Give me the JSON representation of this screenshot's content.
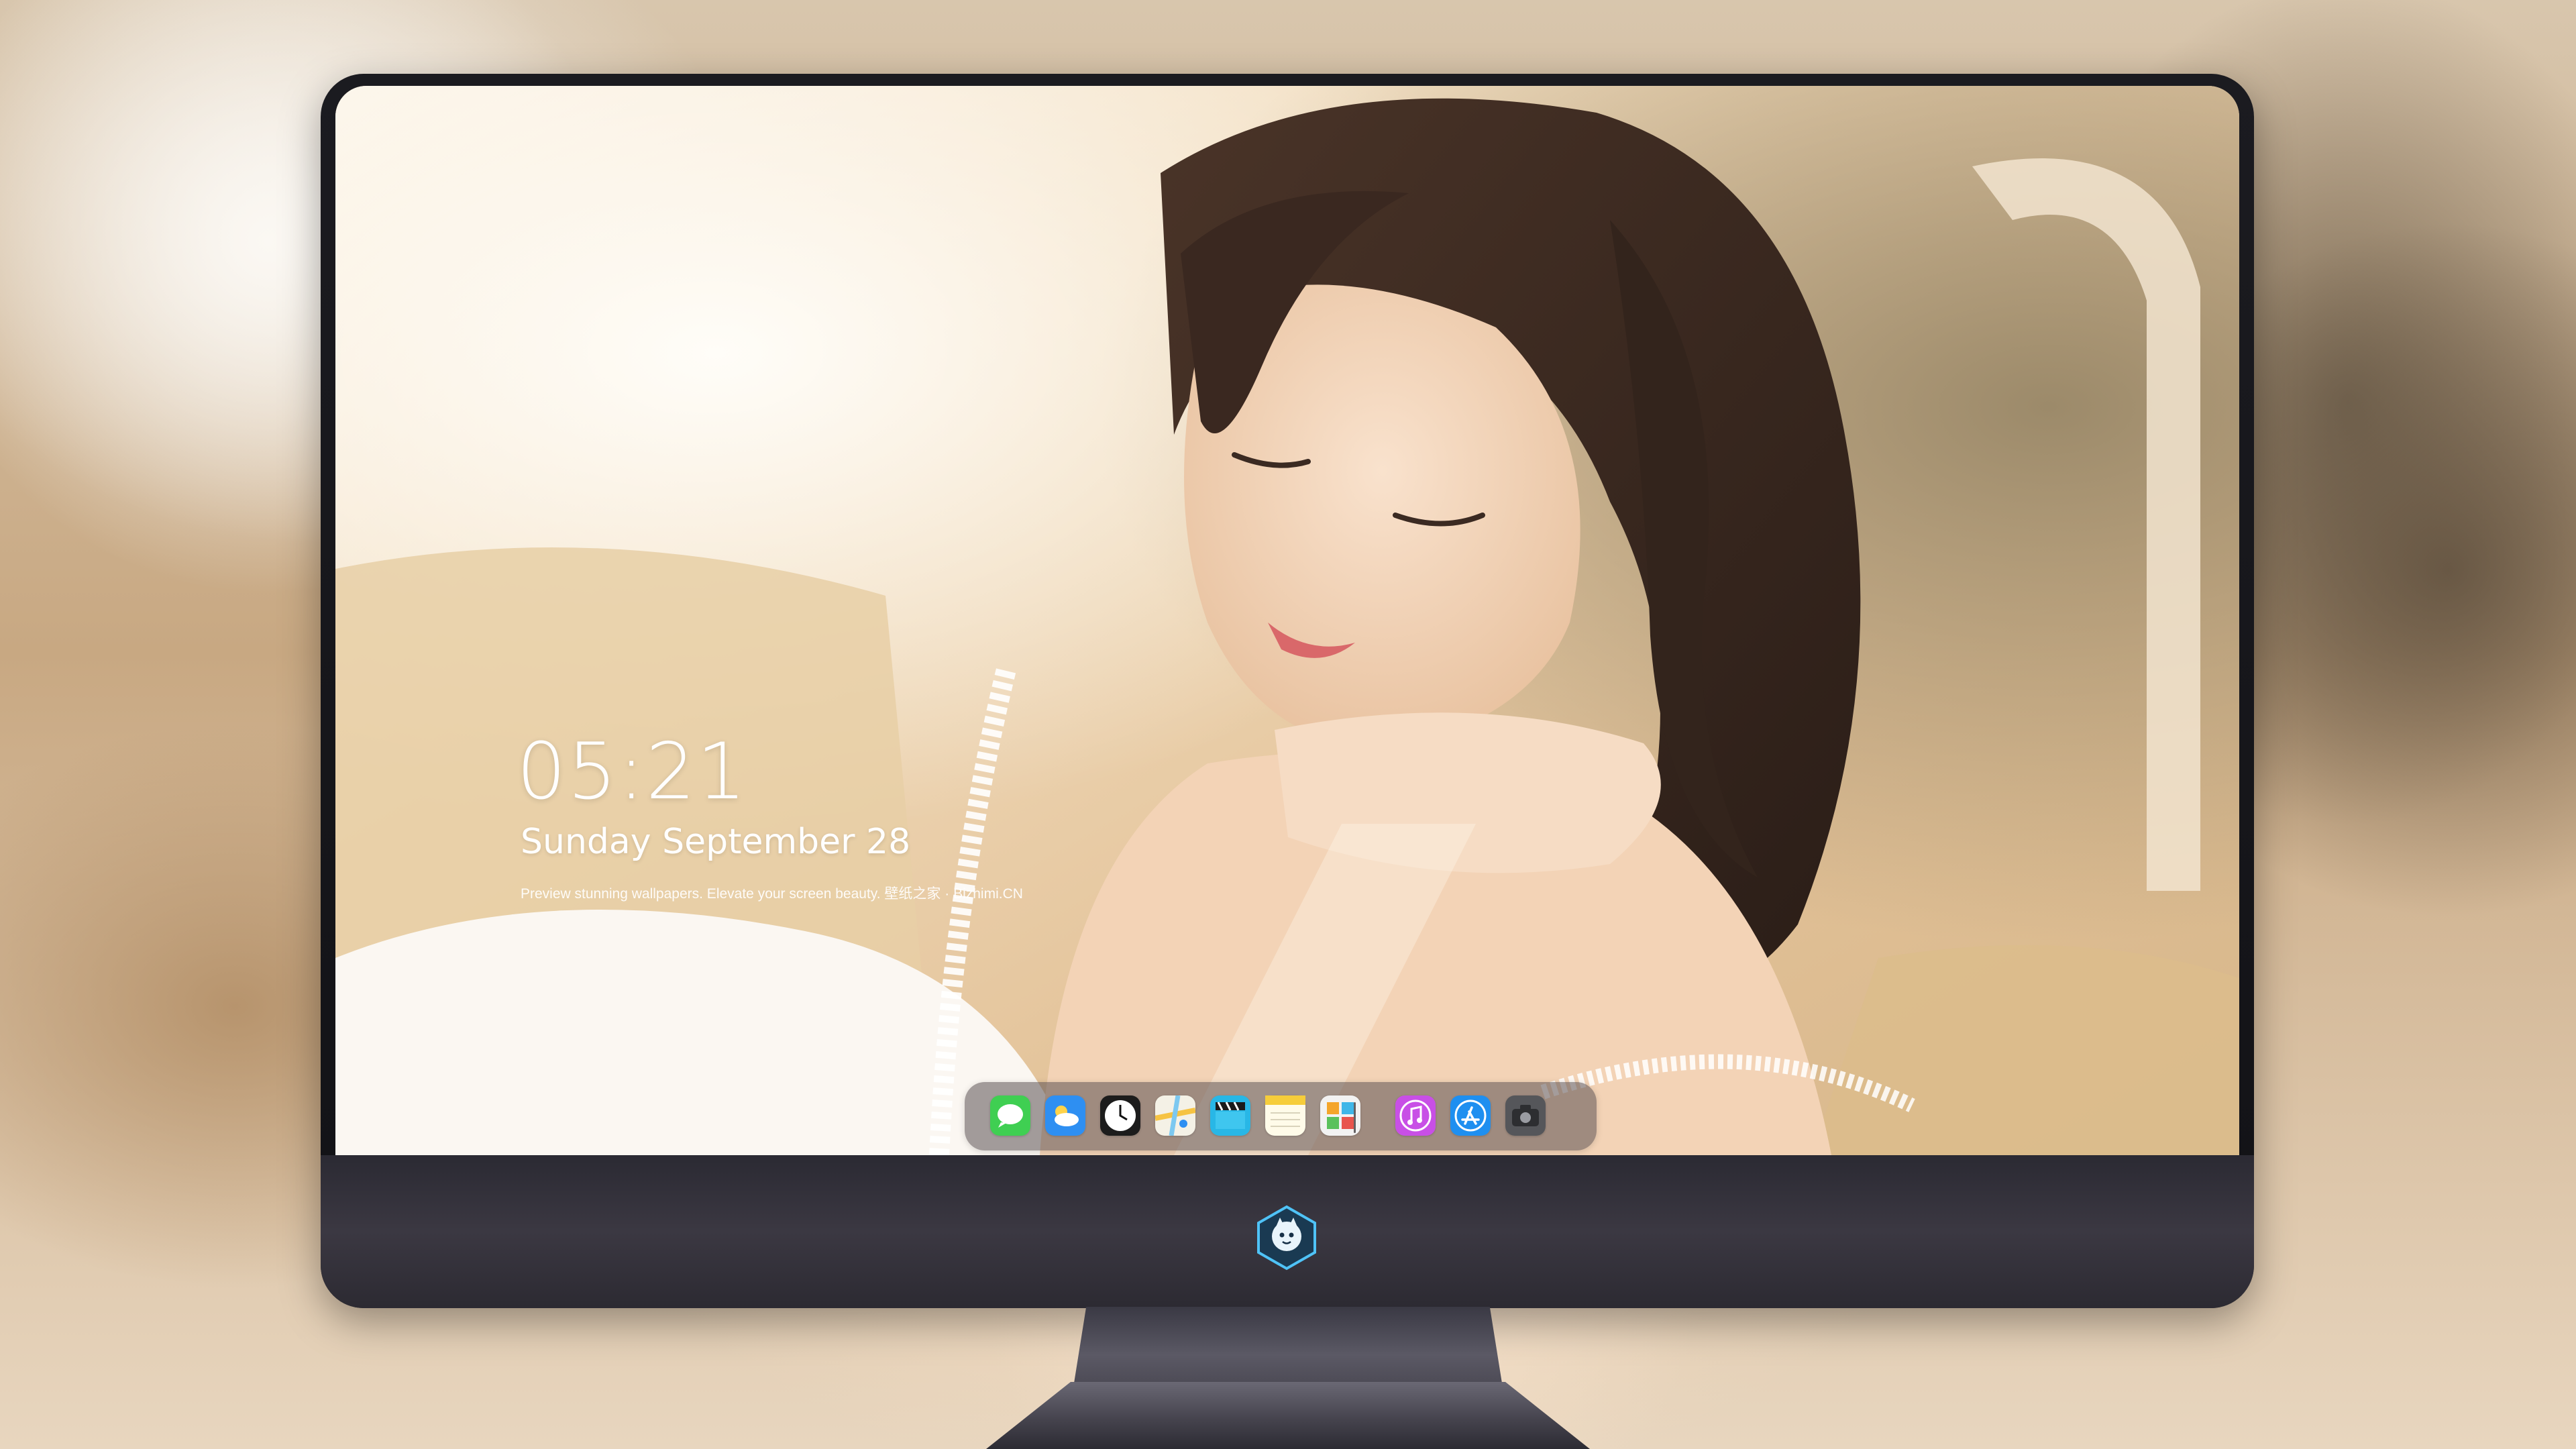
{
  "lockscreen": {
    "time": "05:21",
    "date": "Sunday September  28",
    "caption": "Preview stunning wallpapers. Elevate your screen beauty. 壁纸之家 · Bizhimi.CN"
  },
  "dock": {
    "apps": [
      {
        "name": "messages-icon",
        "glyph": "☁",
        "color": "#3fcf52"
      },
      {
        "name": "weather-icon",
        "glyph": "☁",
        "color": "#2e8ff2"
      },
      {
        "name": "clock-icon",
        "glyph": "◷",
        "color": "#1c1c1c"
      },
      {
        "name": "maps-icon",
        "glyph": "◉",
        "color": "#f4f1e6"
      },
      {
        "name": "clips-icon",
        "glyph": "▶",
        "color": "#28b7e6"
      },
      {
        "name": "notes-icon",
        "glyph": "≡",
        "color": "#fff4c6"
      },
      {
        "name": "photos-icon",
        "glyph": "▦",
        "color": "#f2f2f2"
      },
      {
        "name": "music-icon",
        "glyph": "♫",
        "color": "#c84fe6"
      },
      {
        "name": "app-store-icon",
        "glyph": "A",
        "color": "#1e8ff0"
      },
      {
        "name": "camera-icon",
        "glyph": "◉",
        "color": "#55565a"
      }
    ]
  }
}
